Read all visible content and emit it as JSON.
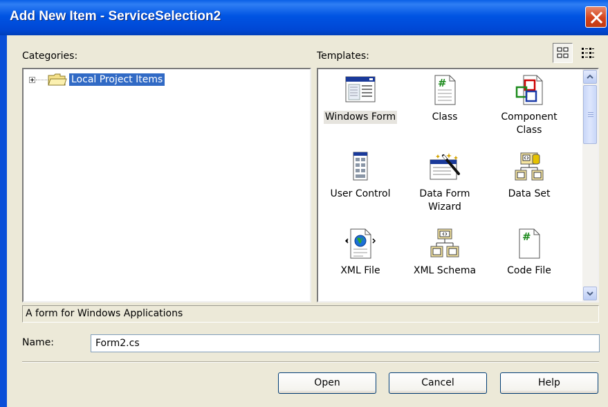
{
  "window": {
    "title": "Add New Item - ServiceSelection2"
  },
  "categories": {
    "label": "Categories:",
    "items": [
      {
        "label": "Local Project Items",
        "selected": true
      }
    ]
  },
  "templates": {
    "label": "Templates:",
    "items": [
      {
        "label": "Windows Form",
        "icon": "windows-form-icon",
        "selected": true
      },
      {
        "label": "Class",
        "icon": "class-file-icon"
      },
      {
        "label": "Component Class",
        "icon": "component-class-icon"
      },
      {
        "label": "User Control",
        "icon": "user-control-icon"
      },
      {
        "label": "Data Form Wizard",
        "icon": "data-form-wizard-icon"
      },
      {
        "label": "Data Set",
        "icon": "data-set-icon"
      },
      {
        "label": "XML File",
        "icon": "xml-file-icon"
      },
      {
        "label": "XML Schema",
        "icon": "xml-schema-icon"
      },
      {
        "label": "Code File",
        "icon": "code-file-icon"
      }
    ]
  },
  "description": "A form for Windows Applications",
  "name_field": {
    "label": "Name:",
    "value": "Form2.cs"
  },
  "buttons": {
    "open": "Open",
    "cancel": "Cancel",
    "help": "Help"
  },
  "colors": {
    "title_bar": "#0054e3",
    "selection": "#316ac5",
    "dialog_bg": "#ece9d8"
  }
}
